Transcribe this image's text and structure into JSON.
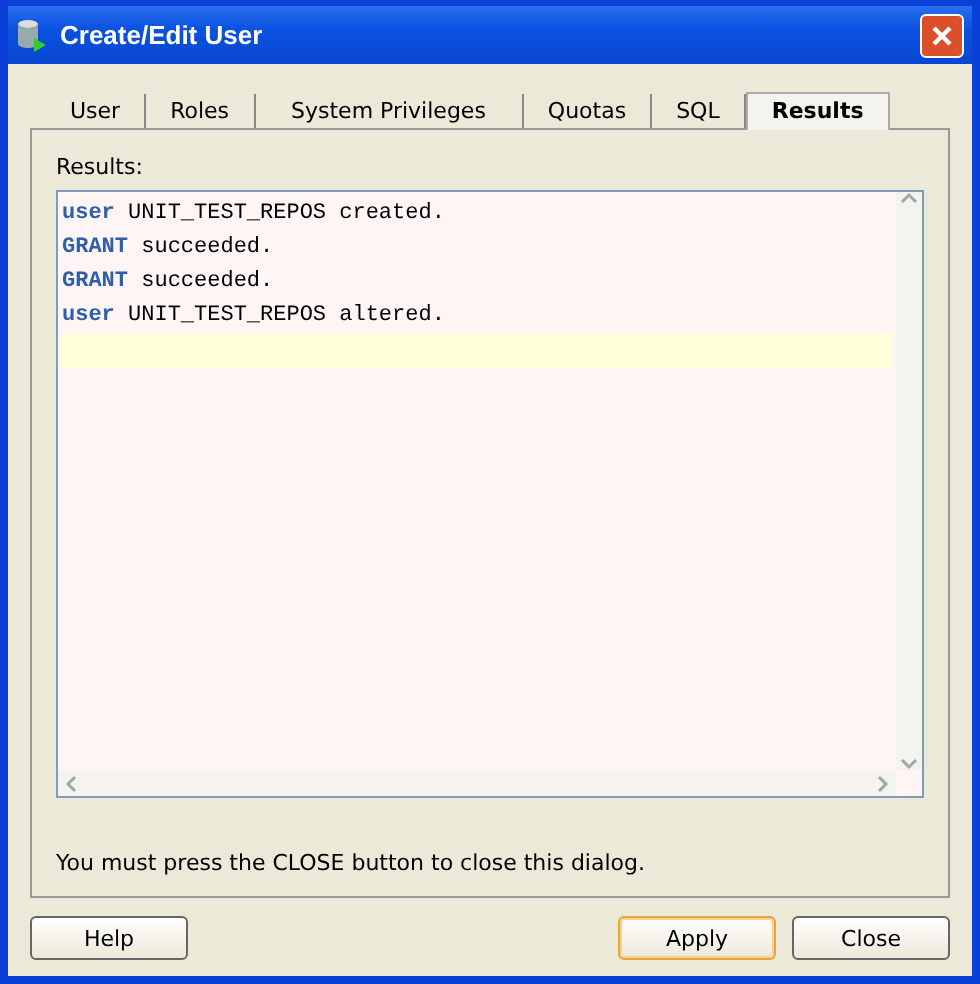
{
  "window": {
    "title": "Create/Edit User"
  },
  "tabs": [
    {
      "label": "User",
      "selected": false
    },
    {
      "label": "Roles",
      "selected": false
    },
    {
      "label": "System Privileges",
      "selected": false
    },
    {
      "label": "Quotas",
      "selected": false
    },
    {
      "label": "SQL",
      "selected": false
    },
    {
      "label": "Results",
      "selected": true
    }
  ],
  "results_label": "Results:",
  "lines": [
    {
      "keyword": "user",
      "text": "UNIT_TEST_REPOS created."
    },
    {
      "keyword": "GRANT",
      "text": "succeeded."
    },
    {
      "keyword": "GRANT",
      "text": "succeeded."
    },
    {
      "keyword": "user",
      "text": "UNIT_TEST_REPOS altered."
    }
  ],
  "message": "You must press the CLOSE button to close this dialog.",
  "buttons": [
    {
      "label": "Help",
      "default": false
    },
    {
      "label": "Apply",
      "default": true
    },
    {
      "label": "Close",
      "default": false
    }
  ]
}
